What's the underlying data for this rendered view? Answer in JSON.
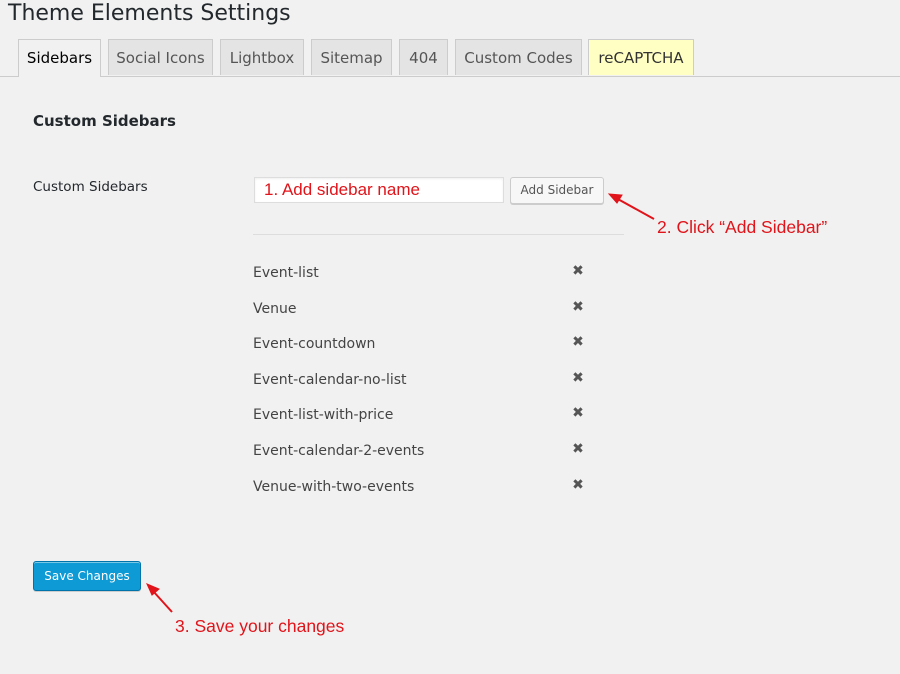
{
  "page": {
    "title": "Theme Elements Settings"
  },
  "tabs": [
    {
      "label": "Sidebars",
      "active": true
    },
    {
      "label": "Social Icons"
    },
    {
      "label": "Lightbox"
    },
    {
      "label": "Sitemap"
    },
    {
      "label": "404"
    },
    {
      "label": "Custom Codes"
    },
    {
      "label": "reCAPTCHA",
      "highlight_color": "#ffffc4"
    }
  ],
  "section": {
    "title": "Custom Sidebars"
  },
  "form": {
    "field_label": "Custom Sidebars",
    "input_value": "1. Add sidebar name",
    "add_button": "Add Sidebar"
  },
  "sidebars": [
    {
      "name": "Event-list",
      "remove_icon": "close-icon"
    },
    {
      "name": "Venue",
      "remove_icon": "close-icon"
    },
    {
      "name": "Event-countdown",
      "remove_icon": "close-icon"
    },
    {
      "name": "Event-calendar-no-list",
      "remove_icon": "close-icon"
    },
    {
      "name": "Event-list-with-price",
      "remove_icon": "close-icon"
    },
    {
      "name": "Event-calendar-2-events",
      "remove_icon": "close-icon"
    },
    {
      "name": "Venue-with-two-events",
      "remove_icon": "close-icon"
    }
  ],
  "save_button": "Save Changes",
  "annotations": {
    "step2": "2. Click “Add Sidebar”",
    "step3": "3. Save your changes",
    "color": "#e0141a"
  },
  "colors": {
    "primary_button": "#0d9ad5",
    "annotation": "#e0141a"
  }
}
